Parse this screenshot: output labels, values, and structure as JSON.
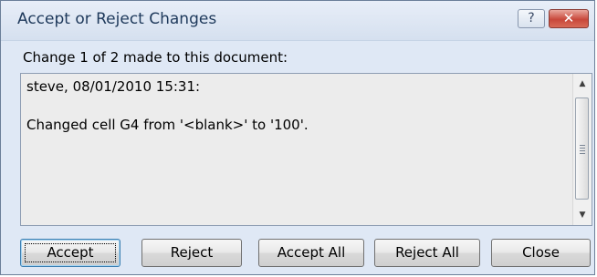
{
  "window": {
    "title": "Accept or Reject Changes",
    "help_glyph": "?",
    "close_glyph": "✕"
  },
  "change_summary": "Change 1 of 2 made to this document:",
  "change_entry": {
    "author_line": "steve, 08/01/2010 15:31:",
    "description": "Changed cell G4 from '<blank>' to '100'."
  },
  "scrollbar": {
    "up_glyph": "▲",
    "down_glyph": "▼"
  },
  "buttons": {
    "accept": "Accept",
    "reject": "Reject",
    "accept_all": "Accept All",
    "reject_all": "Reject All",
    "close": "Close"
  }
}
